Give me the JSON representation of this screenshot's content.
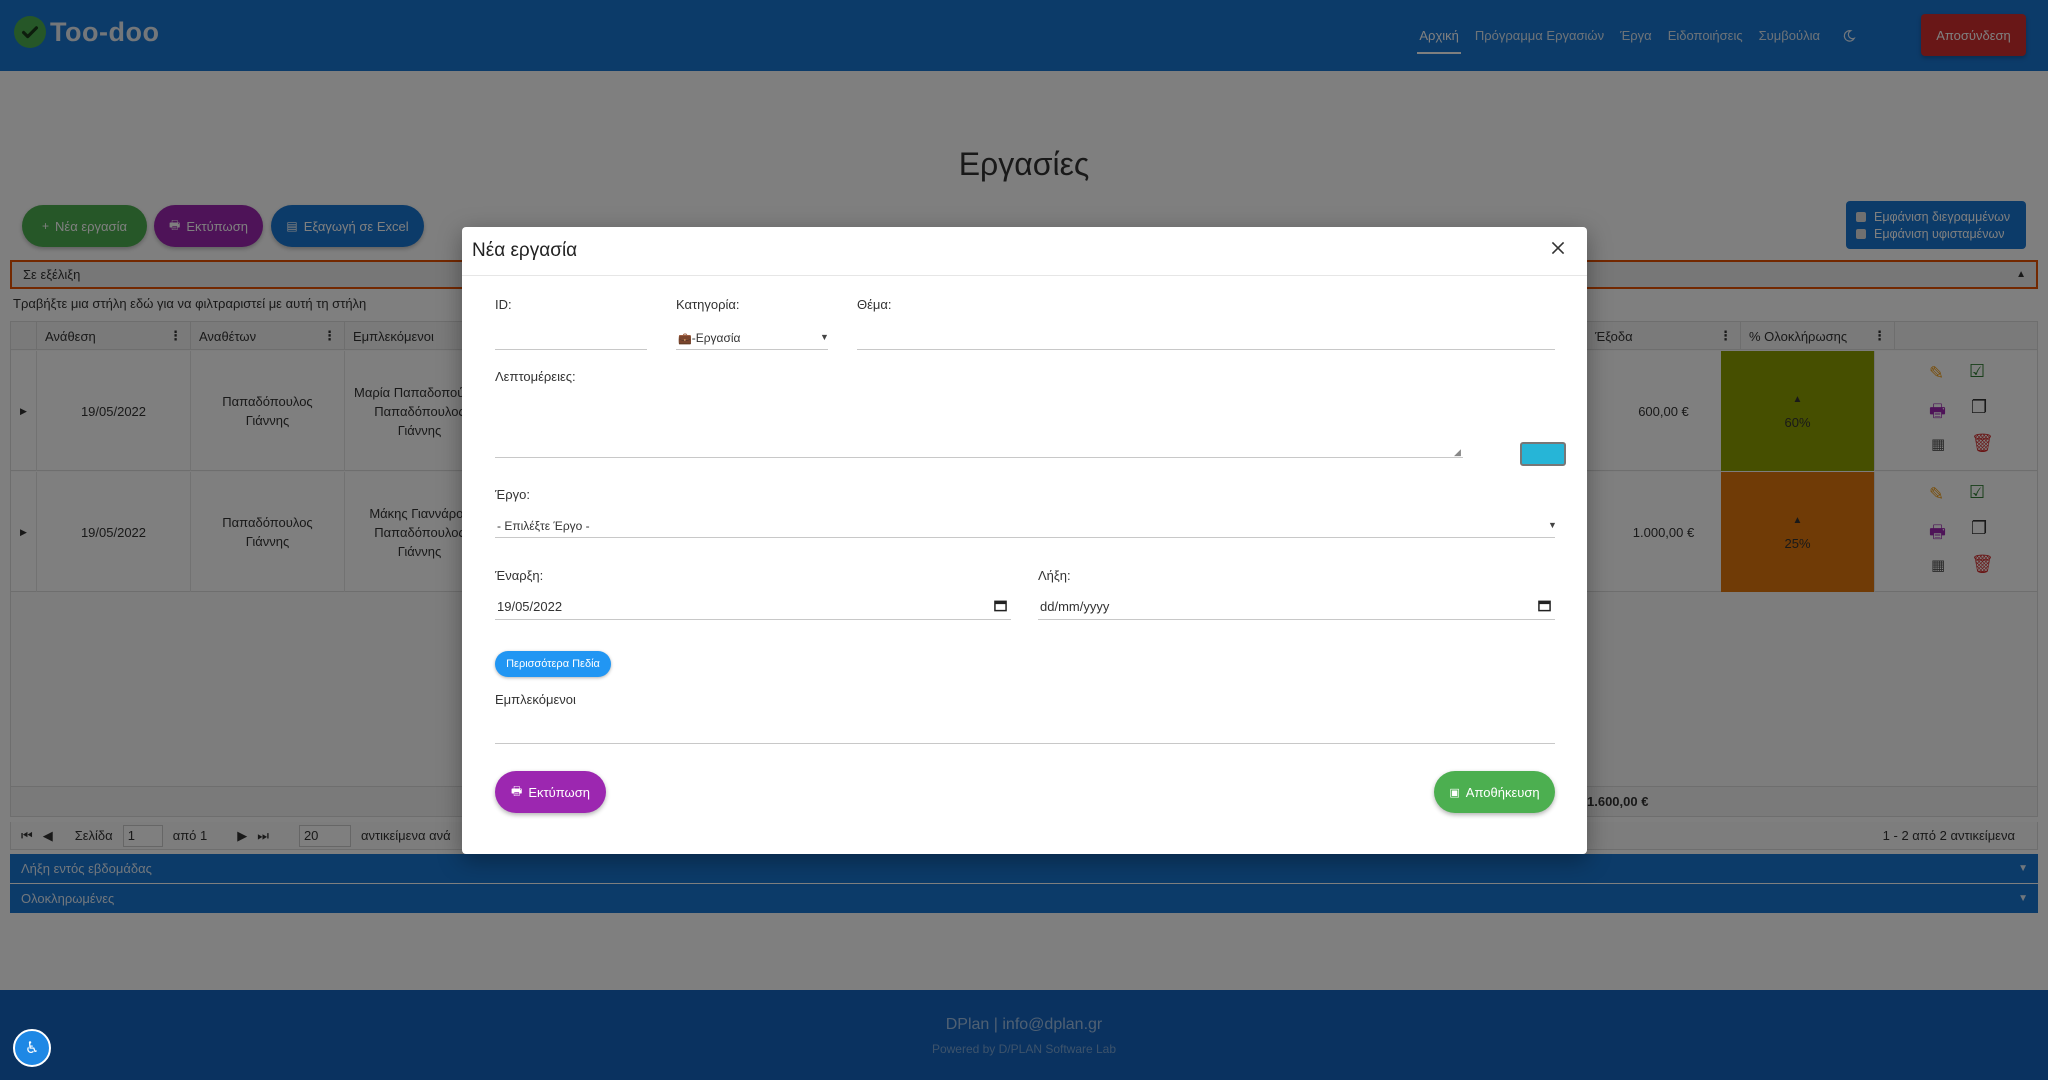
{
  "nav": {
    "brand": "Too-doo",
    "links": [
      {
        "label": "Αρχική",
        "active": true
      },
      {
        "label": "Πρόγραμμα Εργασιών",
        "active": false
      },
      {
        "label": "Έργα",
        "active": false
      },
      {
        "label": "Ειδοποιήσεις",
        "active": false
      },
      {
        "label": "Συμβούλια",
        "active": false
      }
    ],
    "logout": "Αποσύνδεση"
  },
  "page": {
    "title": "Εργασίες",
    "btn_new": "Νέα εργασία",
    "btn_print": "Εκτύπωση",
    "btn_excel": "Εξαγωγή σε Excel",
    "toggle_crossed": "Εμφάνιση διεγραμμένων",
    "toggle_paused": "Εμφάνιση υφισταμένων",
    "panel_inprogress": "Σε εξέλιξη",
    "group_hint": "Τραβήξτε μια στήλη εδώ για να φιλτραριστεί με αυτή τη στήλη",
    "panel_week": "Λήξη εντός εβδομάδας",
    "panel_done": "Ολοκληρωμένες"
  },
  "grid": {
    "headers": {
      "assign": "Ανάθεση",
      "assigner": "Αναθέτων",
      "involved": "Εμπλεκόμενοι",
      "expenses": "Έξοδα",
      "completion": "% Ολοκλήρωσης"
    },
    "rows": [
      {
        "date": "19/05/2022",
        "assigner": "Παπαδόπουλος Γιάννης",
        "involved": "Μαρία Παπαδοπούλου Παπαδόπουλος Γιάννης",
        "expenses": "600,00 €",
        "pct": "60%",
        "pct_color": "#8c9e00"
      },
      {
        "date": "19/05/2022",
        "assigner": "Παπαδόπουλος Γιάννης",
        "involved": "Μάκης Γιαννάρος Παπαδόπουλος Γιάννης",
        "expenses": "1.000,00 €",
        "pct": "25%",
        "pct_color": "#e0760d"
      }
    ],
    "total": "1.600,00 €"
  },
  "pager": {
    "page_label": "Σελίδα",
    "page_value": "1",
    "of_label": "από 1",
    "per_page": "20",
    "per_page_label": "αντικείμενα ανά",
    "summary": "1 - 2 από 2 αντικείμενα"
  },
  "footer": {
    "line1": "DPlan | info@dplan.gr",
    "line2": "Powered by D/PLAN Software Lab"
  },
  "modal": {
    "title": "Νέα εργασία",
    "id_label": "ID:",
    "category_label": "Κατηγορία:",
    "category_value": "-Εργασία",
    "subject_label": "Θέμα:",
    "details_label": "Λεπτομέρειες:",
    "color_value": "#26b5d7",
    "project_label": "Έργο:",
    "project_value": "- Επιλέξτε Έργο -",
    "start_label": "Έναρξη:",
    "start_value": "19/05/2022",
    "end_label": "Λήξη:",
    "end_value": "dd/mm/yyyy",
    "more_fields": "Περισσότερα Πεδία",
    "involved_label": "Εμπλεκόμενοι",
    "print_btn": "Εκτύπωση",
    "save_btn": "Αποθήκευση"
  }
}
